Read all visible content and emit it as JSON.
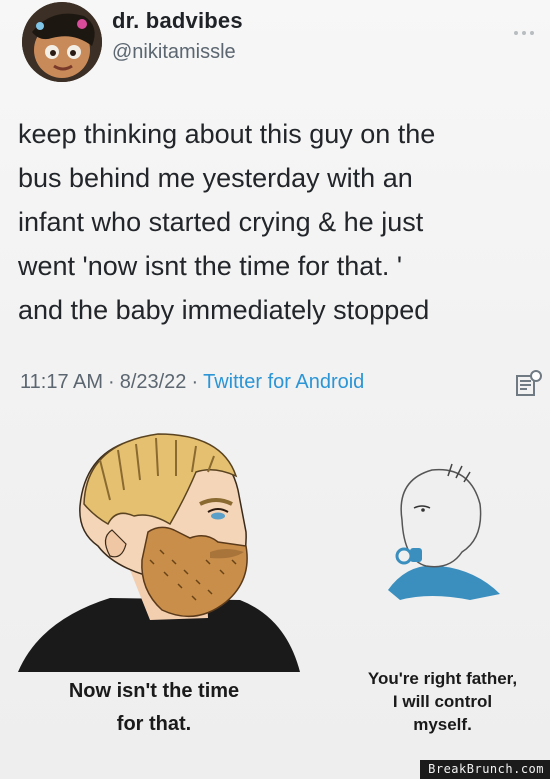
{
  "tweet": {
    "display_name": "dr. badvibes",
    "handle": "@nikitamissle",
    "text": "keep thinking about this guy on the\nbus behind me yesterday with an\ninfant who started crying & he just\nwent 'now isnt the time for that. '\nand the baby immediately stopped",
    "time": "11:17 AM",
    "date": "8/23/22",
    "separator": "·",
    "source": "Twitter for Android",
    "icons": {
      "more": "more-dots-icon",
      "analytics": "analytics-icon",
      "avatar": "avatar-image"
    },
    "colors": {
      "source_link": "#2b95d6",
      "secondary_text": "#5b6670"
    }
  },
  "meme": {
    "left_caption": "Now isn't the time\nfor that.",
    "right_caption": "You're right father,\nI will control\nmyself."
  },
  "watermark": "BreakBrunch.com"
}
